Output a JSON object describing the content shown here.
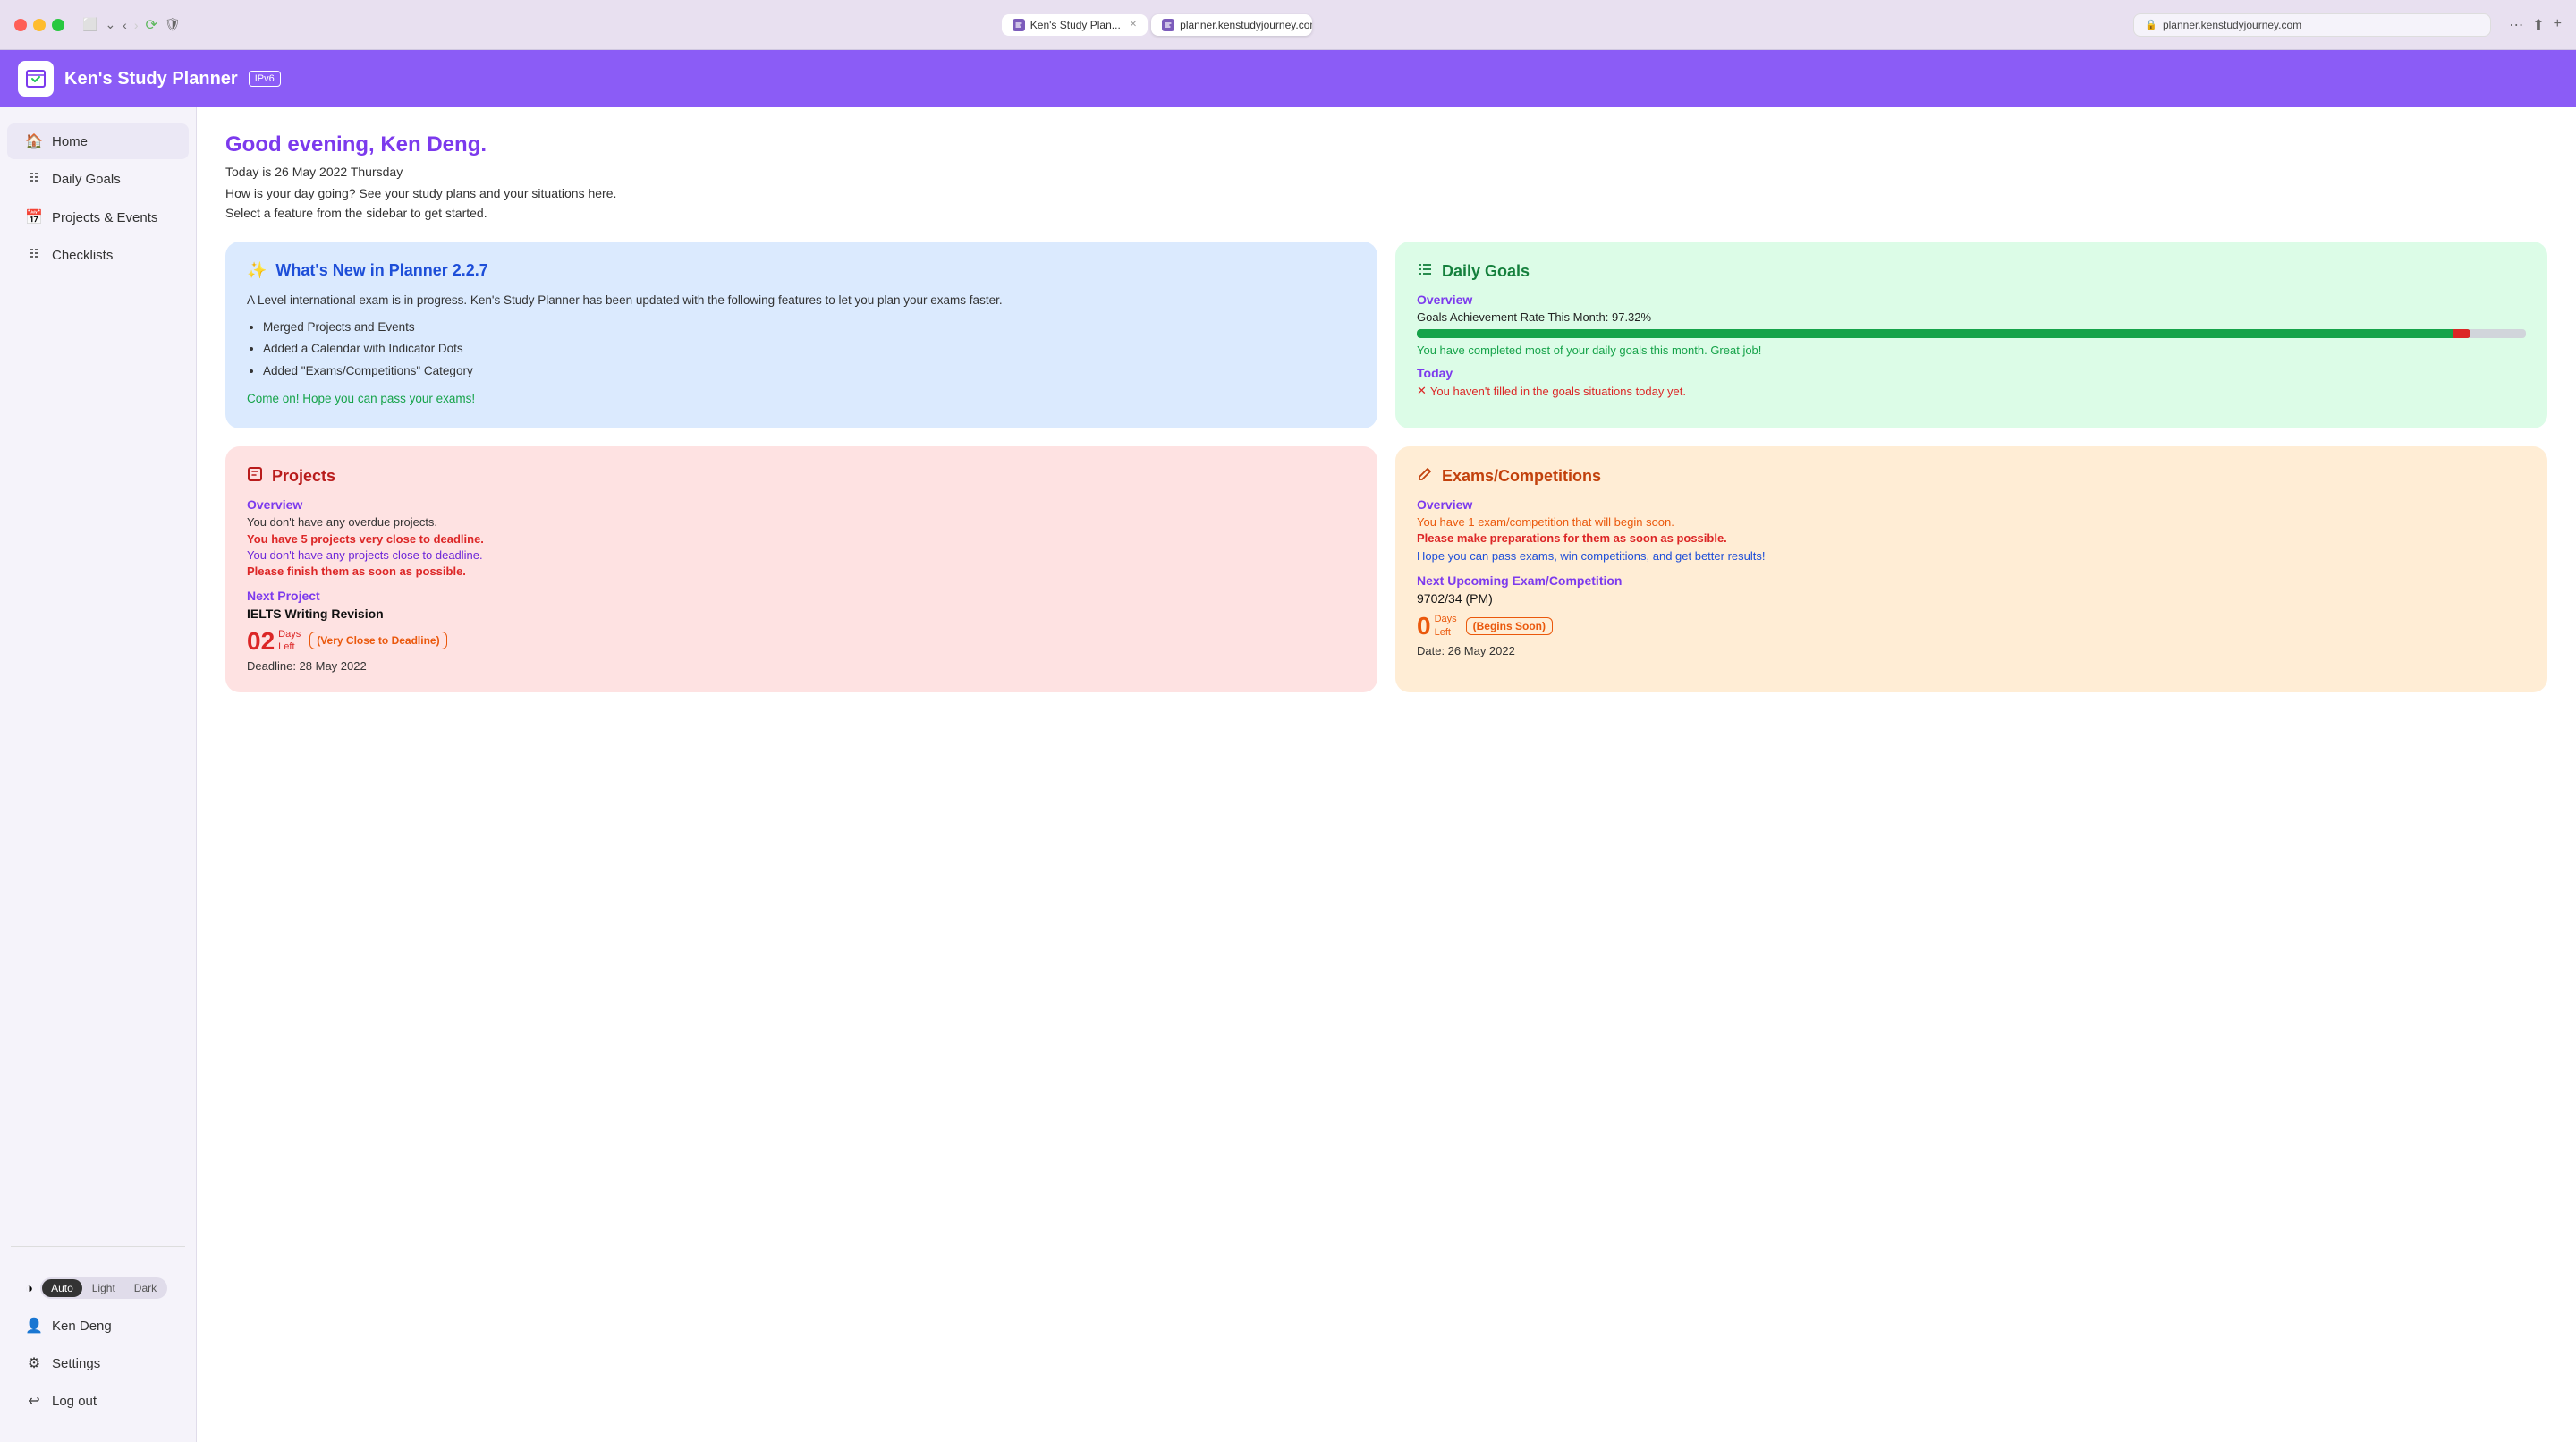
{
  "browser": {
    "tab1_label": "Ken's Study Plan...",
    "tab2_label": "planner.kenstudyjourney.com",
    "address": "planner.kenstudyjourney.com"
  },
  "app": {
    "title": "Ken's Study Planner",
    "badge": "IPv6",
    "greeting": "Good evening, Ken Deng.",
    "date_line": "Today is 26 May 2022 Thursday",
    "welcome": "How is your day going? See your study plans and your situations here.",
    "select": "Select a feature from the sidebar to get started."
  },
  "sidebar": {
    "items": [
      {
        "id": "home",
        "icon": "🏠",
        "label": "Home",
        "active": true
      },
      {
        "id": "daily-goals",
        "icon": "≔",
        "label": "Daily Goals",
        "active": false
      },
      {
        "id": "projects",
        "icon": "📅",
        "label": "Projects & Events",
        "active": false
      },
      {
        "id": "checklists",
        "icon": "≔",
        "label": "Checklists",
        "active": false
      }
    ],
    "theme": {
      "label": "theme-icon",
      "options": [
        "Auto",
        "Light",
        "Dark"
      ],
      "active": "Auto"
    },
    "user": "Ken Deng",
    "settings": "Settings",
    "logout": "Log out"
  },
  "cards": {
    "whats_new": {
      "icon": "✨",
      "title": "What's New in Planner 2.2.7",
      "body": "A Level international exam is in progress. Ken's Study Planner has been updated with the following features to let you plan your exams faster.",
      "features": [
        "Merged Projects and Events",
        "Added a Calendar with Indicator Dots",
        "Added \"Exams/Competitions\" Category"
      ],
      "cta": "Come on! Hope you can pass your exams!"
    },
    "daily_goals": {
      "icon": "≔",
      "title": "Daily Goals",
      "overview_label": "Overview",
      "achievement_text": "Goals Achievement Rate This Month: 97.32%",
      "progress_pct": 97.32,
      "achievement_msg": "You have completed most of your daily goals this month. Great job!",
      "today_label": "Today",
      "today_msg": "✕ You haven't filled in the goals situations today yet."
    },
    "projects": {
      "icon": "▣",
      "title": "Projects",
      "overview_label": "Overview",
      "no_overdue": "You don't have any overdue projects.",
      "warning1": "You have 5 projects very close to deadline.",
      "warning2": "You don't have any projects close to deadline.",
      "warning3": "Please finish them as soon as possible.",
      "next_label": "Next Project",
      "project_name": "IELTS Writing Revision",
      "days_num": "02",
      "days_text1": "Days",
      "days_text2": "Left",
      "badge": "(Very Close to Deadline)",
      "deadline": "Deadline: 28 May 2022"
    },
    "exams": {
      "icon": "✏",
      "title": "Exams/Competitions",
      "overview_label": "Overview",
      "warning1": "You have 1 exam/competition that will begin soon.",
      "warning2": "Please make preparations for them as soon as possible.",
      "hope": "Hope you can pass exams, win competitions, and get better results!",
      "next_label": "Next Upcoming Exam/Competition",
      "exam_name": "9702/34 (PM)",
      "days_num": "0",
      "days_text1": "Days",
      "days_text2": "Left",
      "badge": "(Begins Soon)",
      "date": "Date: 26 May 2022"
    }
  }
}
